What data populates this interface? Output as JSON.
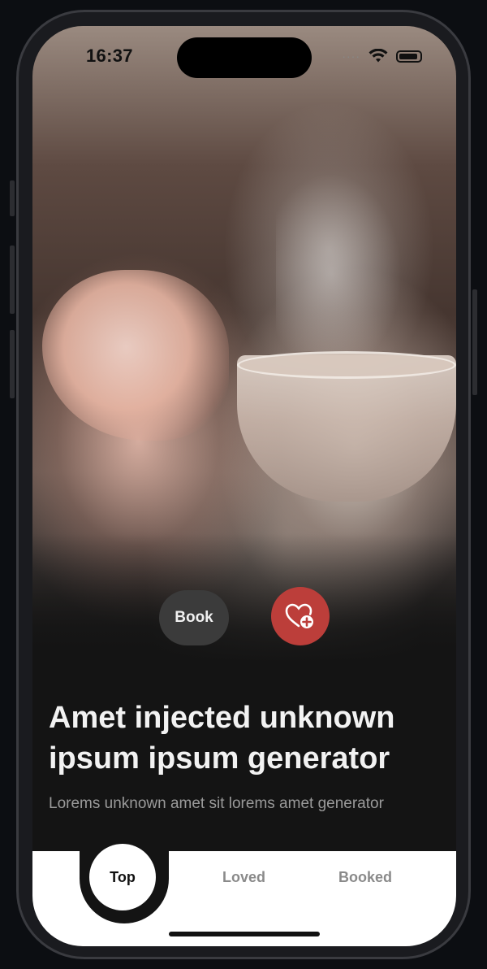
{
  "status_bar": {
    "time": "16:37",
    "signal_dots": "····"
  },
  "hero": {
    "book_label": "Book",
    "love_icon": "heart-plus-icon",
    "love_color": "#bc3e3a"
  },
  "content": {
    "title": "Amet injected unknown ipsum ipsum generator",
    "subtitle": "Lorems unknown amet sit lorems amet generator"
  },
  "tabs": {
    "active": "Top",
    "items": [
      "Top",
      "Loved",
      "Booked"
    ]
  }
}
